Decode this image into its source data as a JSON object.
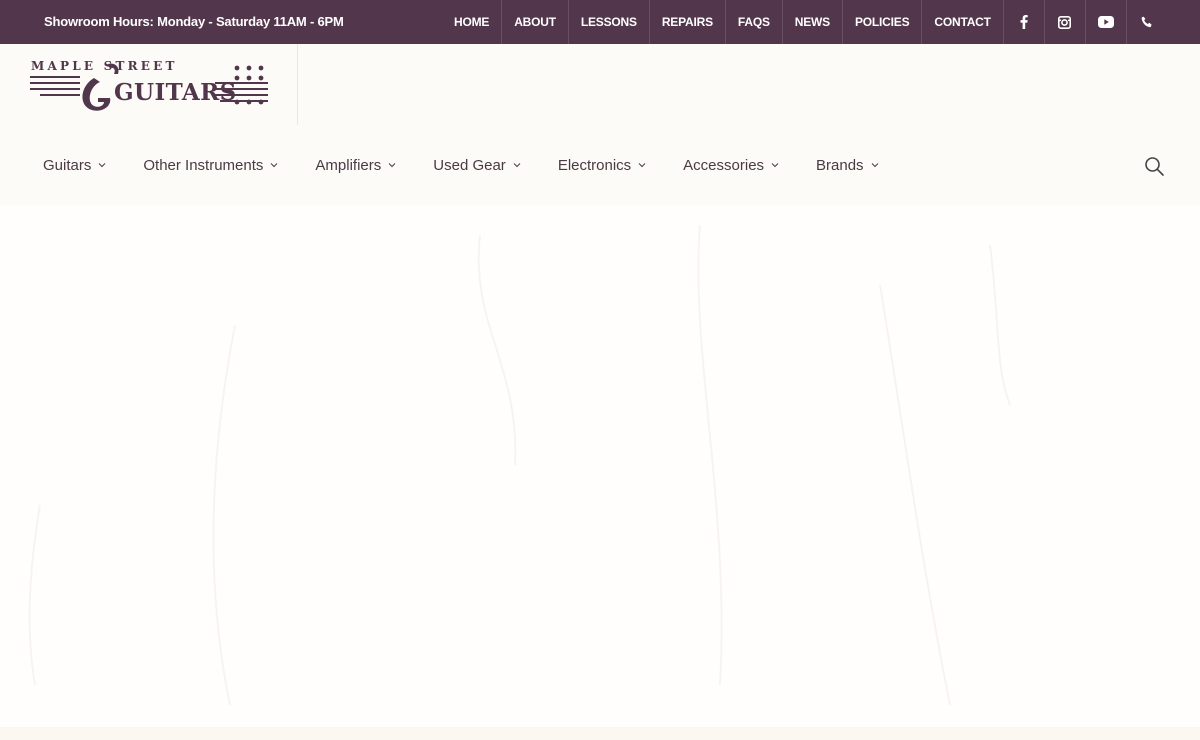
{
  "colors": {
    "topbar": "#52364b",
    "brand": "#52364b",
    "nav_text": "#4a3a44",
    "header_bg": "#fcfbf7"
  },
  "topbar": {
    "hours": "Showroom Hours: Monday - Saturday 11AM - 6PM",
    "links": [
      "HOME",
      "ABOUT",
      "LESSONS",
      "REPAIRS",
      "FAQS",
      "NEWS",
      "POLICIES",
      "CONTACT"
    ],
    "social_icons": [
      "facebook-icon",
      "instagram-icon",
      "youtube-icon",
      "phone-icon"
    ]
  },
  "logo": {
    "top_words": "MAPLE STREET",
    "main_word": "GUITARS"
  },
  "mainnav": {
    "items": [
      "Guitars",
      "Other Instruments",
      "Amplifiers",
      "Used Gear",
      "Electronics",
      "Accessories",
      "Brands"
    ]
  }
}
